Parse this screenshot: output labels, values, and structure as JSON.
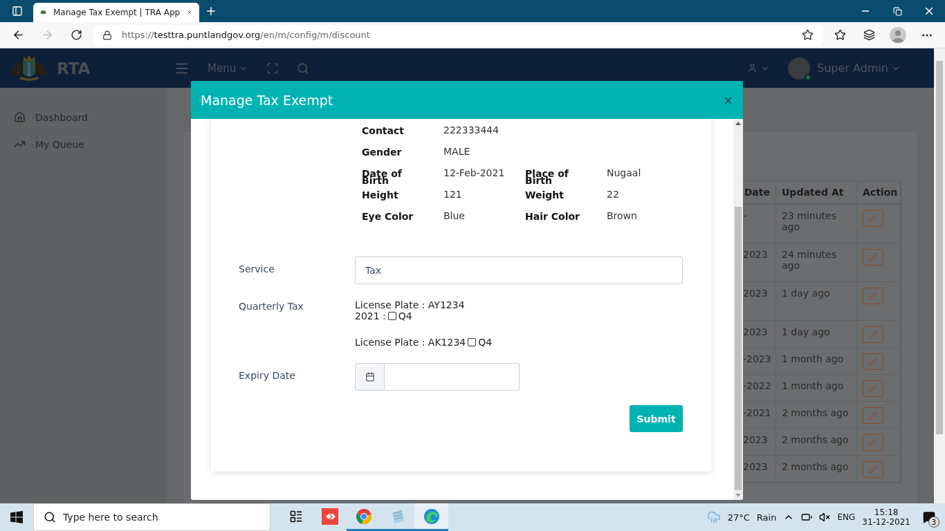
{
  "browser": {
    "tab_title": "Manage Tax Exempt | TRA App",
    "url_scheme": "https://",
    "url_host": "testtra.puntlandgov.org",
    "url_path": "/en/m/config/m/discount"
  },
  "header": {
    "brand": "RTA",
    "menu": "Menu",
    "user": "Super Admin"
  },
  "sidebar": {
    "items": [
      {
        "label": "Dashboard",
        "kind": "home"
      },
      {
        "label": "My Queue",
        "kind": "trend"
      }
    ]
  },
  "table": {
    "columns": [
      "Date",
      "Updated At",
      "Action"
    ],
    "rows": [
      {
        "date": "-",
        "updated": "23 minutes ago"
      },
      {
        "date": "2023",
        "updated": "24 minutes ago"
      },
      {
        "date": "2023",
        "updated": "1 day ago"
      },
      {
        "date": "2023",
        "updated": "1 day ago"
      },
      {
        "date": "-2023",
        "updated": "1 month ago"
      },
      {
        "date": "-2022",
        "updated": "1 month ago"
      },
      {
        "date": "-2021",
        "updated": "2 months ago"
      },
      {
        "date": "2023",
        "updated": "2 months ago"
      },
      {
        "date": "2023",
        "updated": "2 months ago"
      }
    ]
  },
  "modal": {
    "title": "Manage Tax Exempt",
    "close": "×",
    "details": [
      [
        {
          "label": "Contact",
          "value": "222333444"
        }
      ],
      [
        {
          "label": "Gender",
          "value": "MALE"
        }
      ],
      [
        {
          "label": "Date of Birth",
          "value": "12-Feb-2021"
        },
        {
          "label": "Place of Birth",
          "value": "Nugaal"
        }
      ],
      [
        {
          "label": "Height",
          "value": "121"
        },
        {
          "label": "Weight",
          "value": "22"
        }
      ],
      [
        {
          "label": "Eye Color",
          "value": "Blue"
        },
        {
          "label": "Hair Color",
          "value": "Brown"
        }
      ]
    ],
    "service": {
      "label": "Service",
      "value": "Tax"
    },
    "quarterly": {
      "label": "Quarterly Tax",
      "plates": [
        {
          "kind": "stacked",
          "plate": "License Plate : AY1234",
          "year": "2021 :",
          "quarter": "Q4",
          "checked": false
        },
        {
          "kind": "inline",
          "plate": "License Plate : AK1234",
          "quarter": "Q4",
          "checked": false
        }
      ]
    },
    "expiry": {
      "label": "Expiry Date"
    },
    "submit": "Submit"
  },
  "taskbar": {
    "search_placeholder": "Type here to search",
    "apps": [
      {
        "kind": "taskview",
        "running": false,
        "selected": false
      },
      {
        "kind": "anydesk",
        "running": false,
        "selected": false
      },
      {
        "kind": "chrome",
        "running": true,
        "selected": false
      },
      {
        "kind": "notepad",
        "running": true,
        "selected": false
      },
      {
        "kind": "edge",
        "running": true,
        "selected": true
      }
    ],
    "temperature": "27°C",
    "weather": "Rain",
    "language": "ENG",
    "time": "15:18",
    "date": "31-12-2021",
    "notifications": "3"
  }
}
